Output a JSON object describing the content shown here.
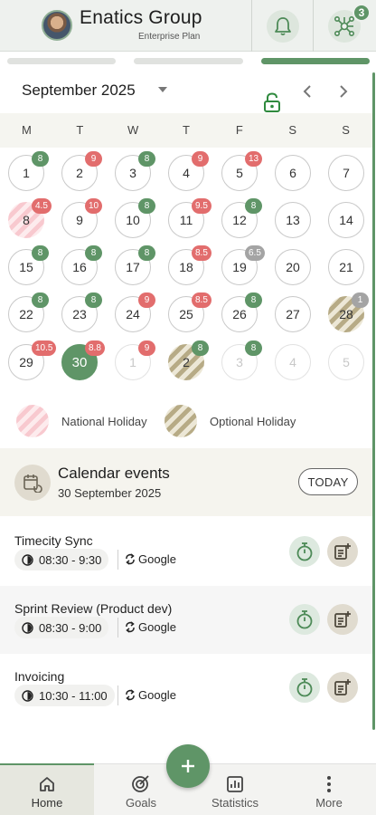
{
  "colors": {
    "accent": "#5f9567",
    "busy": "#e26d6d",
    "neutral": "#a4a4a4",
    "national_holiday": "#f8c9cf",
    "optional_holiday": "#b7ab86"
  },
  "header": {
    "company": "Enatics Group",
    "plan": "Enterprise Plan",
    "integrations_badge": "3"
  },
  "calendar": {
    "month_label": "September 2025",
    "weekdays": [
      "M",
      "T",
      "W",
      "T",
      "F",
      "S",
      "S"
    ],
    "days": [
      {
        "label": "1",
        "badge": "8",
        "badge_color": "green",
        "style": "normal"
      },
      {
        "label": "2",
        "badge": "9",
        "badge_color": "red",
        "style": "normal"
      },
      {
        "label": "3",
        "badge": "8",
        "badge_color": "green",
        "style": "normal"
      },
      {
        "label": "4",
        "badge": "9",
        "badge_color": "red",
        "style": "normal"
      },
      {
        "label": "5",
        "badge": "13",
        "badge_color": "red",
        "style": "normal"
      },
      {
        "label": "6",
        "badge": "",
        "badge_color": "",
        "style": "normal"
      },
      {
        "label": "7",
        "badge": "",
        "badge_color": "",
        "style": "normal"
      },
      {
        "label": "8",
        "badge": "4.5",
        "badge_color": "red",
        "style": "national"
      },
      {
        "label": "9",
        "badge": "10",
        "badge_color": "red",
        "style": "normal"
      },
      {
        "label": "10",
        "badge": "8",
        "badge_color": "green",
        "style": "normal"
      },
      {
        "label": "11",
        "badge": "9.5",
        "badge_color": "red",
        "style": "normal"
      },
      {
        "label": "12",
        "badge": "8",
        "badge_color": "green",
        "style": "normal"
      },
      {
        "label": "13",
        "badge": "",
        "badge_color": "",
        "style": "normal"
      },
      {
        "label": "14",
        "badge": "",
        "badge_color": "",
        "style": "normal"
      },
      {
        "label": "15",
        "badge": "8",
        "badge_color": "green",
        "style": "normal"
      },
      {
        "label": "16",
        "badge": "8",
        "badge_color": "green",
        "style": "normal"
      },
      {
        "label": "17",
        "badge": "8",
        "badge_color": "green",
        "style": "normal"
      },
      {
        "label": "18",
        "badge": "8.5",
        "badge_color": "red",
        "style": "normal"
      },
      {
        "label": "19",
        "badge": "6.5",
        "badge_color": "grey",
        "style": "normal"
      },
      {
        "label": "20",
        "badge": "",
        "badge_color": "",
        "style": "normal"
      },
      {
        "label": "21",
        "badge": "",
        "badge_color": "",
        "style": "normal"
      },
      {
        "label": "22",
        "badge": "8",
        "badge_color": "green",
        "style": "normal"
      },
      {
        "label": "23",
        "badge": "8",
        "badge_color": "green",
        "style": "normal"
      },
      {
        "label": "24",
        "badge": "9",
        "badge_color": "red",
        "style": "normal"
      },
      {
        "label": "25",
        "badge": "8.5",
        "badge_color": "red",
        "style": "normal"
      },
      {
        "label": "26",
        "badge": "8",
        "badge_color": "green",
        "style": "normal"
      },
      {
        "label": "27",
        "badge": "",
        "badge_color": "",
        "style": "normal"
      },
      {
        "label": "28",
        "badge": "1",
        "badge_color": "grey",
        "style": "optional"
      },
      {
        "label": "29",
        "badge": "10.5",
        "badge_color": "red",
        "style": "normal"
      },
      {
        "label": "30",
        "badge": "8.8",
        "badge_color": "red",
        "style": "today"
      },
      {
        "label": "1",
        "badge": "9",
        "badge_color": "red",
        "style": "faded"
      },
      {
        "label": "2",
        "badge": "8",
        "badge_color": "green",
        "style": "optional"
      },
      {
        "label": "3",
        "badge": "8",
        "badge_color": "green",
        "style": "faded"
      },
      {
        "label": "4",
        "badge": "",
        "badge_color": "",
        "style": "faded"
      },
      {
        "label": "5",
        "badge": "",
        "badge_color": "",
        "style": "faded"
      }
    ]
  },
  "legend": {
    "national": "National Holiday",
    "optional": "Optional Holiday"
  },
  "events_header": {
    "title": "Calendar events",
    "date": "30 September 2025",
    "today_button": "TODAY"
  },
  "events": [
    {
      "name": "Timecity Sync",
      "time": "08:30 - 9:30",
      "source": "Google"
    },
    {
      "name": "Sprint Review (Product dev)",
      "time": "08:30 - 9:00",
      "source": "Google"
    },
    {
      "name": "Invoicing",
      "time": "10:30 - 11:00",
      "source": "Google"
    }
  ],
  "nav": {
    "home": "Home",
    "goals": "Goals",
    "statistics": "Statistics",
    "more": "More"
  }
}
